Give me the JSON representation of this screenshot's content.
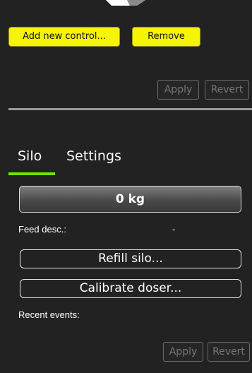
{
  "top_controls": {
    "add_label": "Add new control...",
    "remove_label": "Remove",
    "apply_label": "Apply",
    "revert_label": "Revert"
  },
  "tabs": [
    {
      "label": "Silo",
      "active": true
    },
    {
      "label": "Settings",
      "active": false
    }
  ],
  "silo": {
    "weight": "0 kg",
    "feed_desc_label": "Feed desc.:",
    "feed_desc_value": "-",
    "refill_label": "Refill silo...",
    "calibrate_label": "Calibrate doser...",
    "recent_events_label": "Recent events:",
    "apply_label": "Apply",
    "revert_label": "Revert"
  },
  "colors": {
    "background": "#222222",
    "accent_button": "#f5f500",
    "tab_underline": "#74e000"
  }
}
